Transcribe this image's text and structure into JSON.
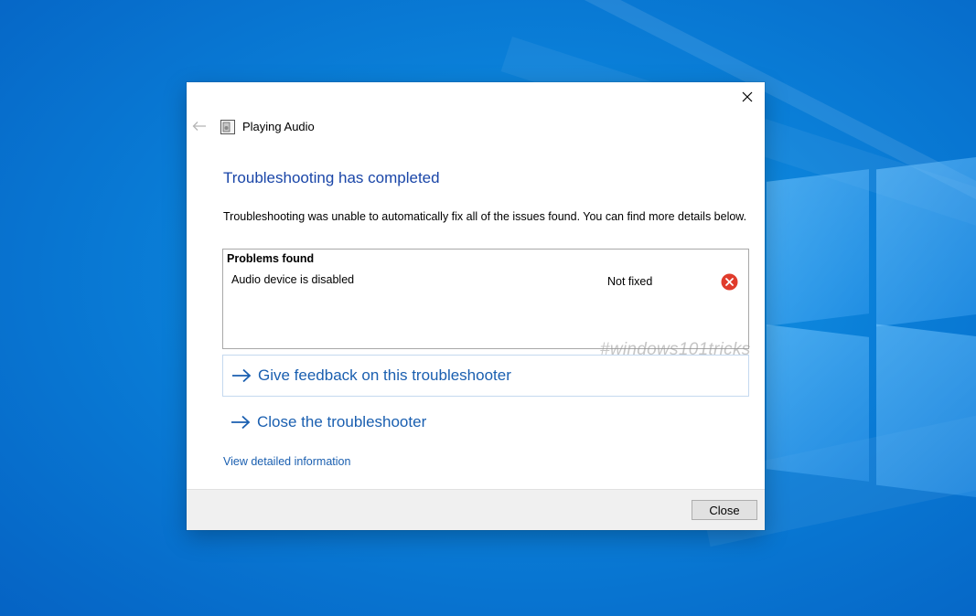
{
  "dialog": {
    "app_title": "Playing Audio",
    "heading": "Troubleshooting has completed",
    "description": "Troubleshooting was unable to automatically fix all of the issues found. You can find more details below.",
    "problems": {
      "header": "Problems found",
      "items": [
        {
          "name": "Audio device is disabled",
          "status": "Not fixed",
          "status_icon": "error-icon"
        }
      ]
    },
    "commands": [
      {
        "label": "Give feedback on this troubleshooter",
        "icon": "arrow-right-icon"
      },
      {
        "label": "Close the troubleshooter",
        "icon": "arrow-right-icon"
      }
    ],
    "detail_link": "View detailed information",
    "close_button": "Close"
  },
  "watermark": "#windows101tricks",
  "colors": {
    "heading": "#1a46a8",
    "link": "#1a5fb0",
    "error": "#e03c2c",
    "desktop": "#0a7fd8"
  }
}
